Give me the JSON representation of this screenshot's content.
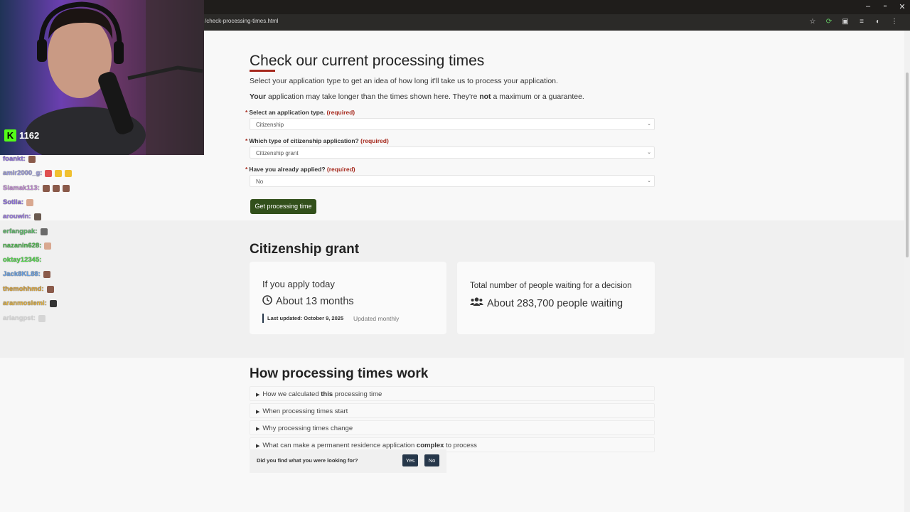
{
  "browser": {
    "url": "/check-processing-times.html",
    "window_controls": [
      "–",
      "▫",
      "✕"
    ]
  },
  "page": {
    "title": "Check our current processing times",
    "intro_1": "Select your application type to get an idea of how long it'll take us to process your application.",
    "intro_2_prefix": "Your",
    "intro_2_middle": " application may take longer than the times shown here. They're ",
    "intro_2_not": "not",
    "intro_2_suffix": " a maximum or a guarantee.",
    "required_star": "*",
    "required_text": "(required)",
    "fields": [
      {
        "label": "Select an application type.",
        "value": "Citizenship"
      },
      {
        "label": "Which type of citizenship application?",
        "value": "Citizenship grant"
      },
      {
        "label": "Have you already applied?",
        "value": "No"
      }
    ],
    "submit_label": "Get processing time"
  },
  "result": {
    "heading": "Citizenship grant",
    "apply_today_label": "If you apply today",
    "duration": "About 13 months",
    "last_updated": "Last updated: October 9, 2025",
    "update_frequency": "Updated monthly",
    "waiting_label": "Total number of people waiting for a decision",
    "waiting_value": "About 283,700 people waiting"
  },
  "how": {
    "heading": "How processing times work",
    "items": [
      {
        "pre": "How we calculated ",
        "bold": "this",
        "post": " processing time"
      },
      {
        "pre": "When processing times start",
        "bold": "",
        "post": ""
      },
      {
        "pre": "Why processing times change",
        "bold": "",
        "post": ""
      },
      {
        "pre": "What can make a permanent residence application ",
        "bold": "complex",
        "post": " to process"
      }
    ]
  },
  "feedback": {
    "question": "Did you find what you were looking for?",
    "yes": "Yes",
    "no": "No"
  },
  "stream": {
    "viewer_count": "1162",
    "chat": [
      {
        "user": "foankt:",
        "color": "#8c6fd8",
        "msg": ""
      },
      {
        "user": "amir2000_g:",
        "color": "#9a9ad8",
        "msg": ""
      },
      {
        "user": "Siamak113:",
        "color": "#c58fd6",
        "msg": ""
      },
      {
        "user": "Sotila:",
        "color": "#8c6fd8",
        "msg": ""
      },
      {
        "user": "arouwin:",
        "color": "#9b7be0",
        "msg": ""
      },
      {
        "user": "erfangpak:",
        "color": "#5fb86a",
        "msg": ""
      },
      {
        "user": "nazanin628:",
        "color": "#4cb84c",
        "msg": ""
      },
      {
        "user": "oktay12345:",
        "color": "#55d84e",
        "msg": ""
      },
      {
        "user": "Jack8KL88:",
        "color": "#6aa0e0",
        "msg": ""
      },
      {
        "user": "themohhmd:",
        "color": "#d8a33a",
        "msg": ""
      },
      {
        "user": "aranmoslemi:",
        "color": "#e0b040",
        "msg": ""
      },
      {
        "user": "ariangpst:",
        "color": "#888888",
        "msg": ""
      }
    ]
  },
  "colors": {
    "accent_red": "#a62a1e",
    "primary_green": "#32501b",
    "navy": "#26374a"
  }
}
